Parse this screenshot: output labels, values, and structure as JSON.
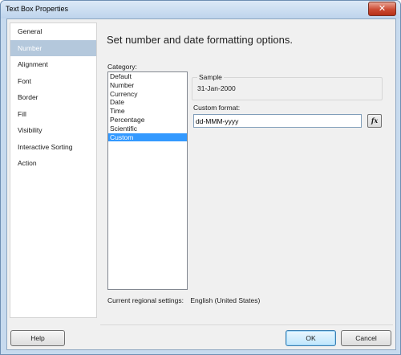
{
  "window": {
    "title": "Text Box Properties"
  },
  "sidebar": {
    "items": [
      {
        "label": "General"
      },
      {
        "label": "Number"
      },
      {
        "label": "Alignment"
      },
      {
        "label": "Font"
      },
      {
        "label": "Border"
      },
      {
        "label": "Fill"
      },
      {
        "label": "Visibility"
      },
      {
        "label": "Interactive Sorting"
      },
      {
        "label": "Action"
      }
    ],
    "selected": "Number"
  },
  "main": {
    "heading": "Set number and date formatting options.",
    "category_label": "Category:",
    "categories": [
      "Default",
      "Number",
      "Currency",
      "Date",
      "Time",
      "Percentage",
      "Scientific",
      "Custom"
    ],
    "selected_category": "Custom",
    "sample": {
      "label": "Sample",
      "value": "31-Jan-2000"
    },
    "custom_format": {
      "label": "Custom format:",
      "value": "dd-MMM-yyyy"
    },
    "fx_button": "fx",
    "regional": {
      "label": "Current regional settings:",
      "value": "English (United States)"
    }
  },
  "footer": {
    "help_label": "Help",
    "ok_label": "OK",
    "cancel_label": "Cancel"
  },
  "colors": {
    "selection_blue": "#3399ff",
    "sidebar_selected": "#b4c8dc",
    "close_red": "#cc4a33"
  }
}
